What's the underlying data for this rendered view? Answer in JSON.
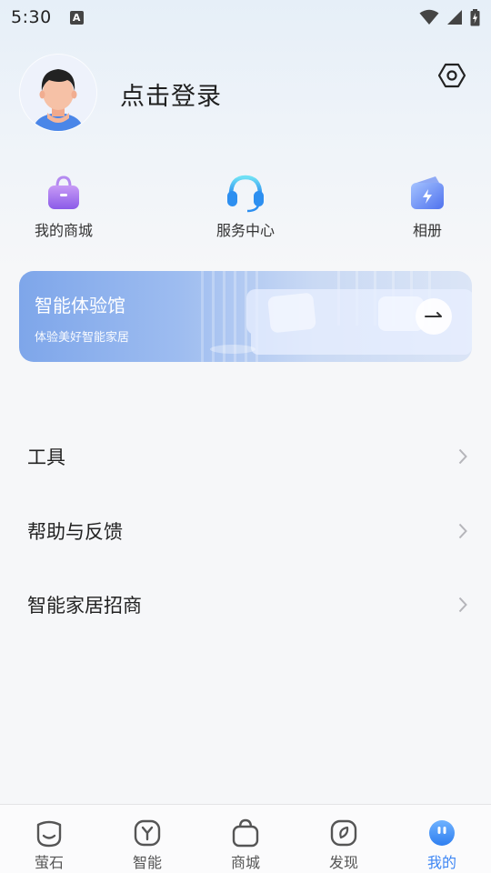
{
  "status_bar": {
    "time": "5:30",
    "indicator": "A"
  },
  "profile": {
    "login_label": "点击登录",
    "avatar_icon": "avatar-icon",
    "settings_icon": "settings-icon"
  },
  "quick_actions": [
    {
      "label": "我的商城",
      "icon": "shopping-bag-icon"
    },
    {
      "label": "服务中心",
      "icon": "headset-icon"
    },
    {
      "label": "相册",
      "icon": "album-icon"
    }
  ],
  "banner": {
    "title": "智能体验馆",
    "subtitle": "体验美好智能家居",
    "arrow_icon": "arrow-right-icon"
  },
  "menu": [
    {
      "label": "工具"
    },
    {
      "label": "帮助与反馈"
    },
    {
      "label": "智能家居招商"
    }
  ],
  "bottom_nav": [
    {
      "label": "萤石",
      "icon": "home-icon",
      "active": false
    },
    {
      "label": "智能",
      "icon": "smart-icon",
      "active": false
    },
    {
      "label": "商城",
      "icon": "mall-icon",
      "active": false
    },
    {
      "label": "发现",
      "icon": "discover-icon",
      "active": false
    },
    {
      "label": "我的",
      "icon": "profile-icon",
      "active": true
    }
  ],
  "colors": {
    "accent": "#3d86f4",
    "banner_start": "#7ea6ea",
    "text_primary": "#222222"
  }
}
